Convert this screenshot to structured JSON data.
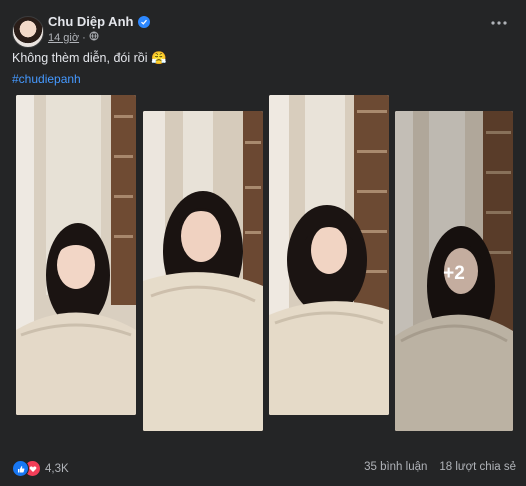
{
  "post": {
    "author": "Chu Diệp Anh",
    "time": "14 giờ",
    "caption": "Không thèm diễn, đói rồi 😤",
    "hashtag": "#chudiepanh",
    "more_photos": "+2"
  },
  "icons": {
    "verified": "verified-badge-icon",
    "audience": "globe-icon",
    "options": "more-options-icon",
    "like": "like-reaction-icon",
    "love": "love-reaction-icon"
  },
  "footer": {
    "reaction_count": "4,3K",
    "comments": "35 bình luận",
    "shares": "18 lượt chia sẻ"
  },
  "colors": {
    "background": "#242526",
    "text_primary": "#e4e6eb",
    "text_secondary": "#b0b3b8",
    "link": "#4599ff",
    "verified": "#2d88ff",
    "like": "#1877f2",
    "love": "#f33e58"
  }
}
